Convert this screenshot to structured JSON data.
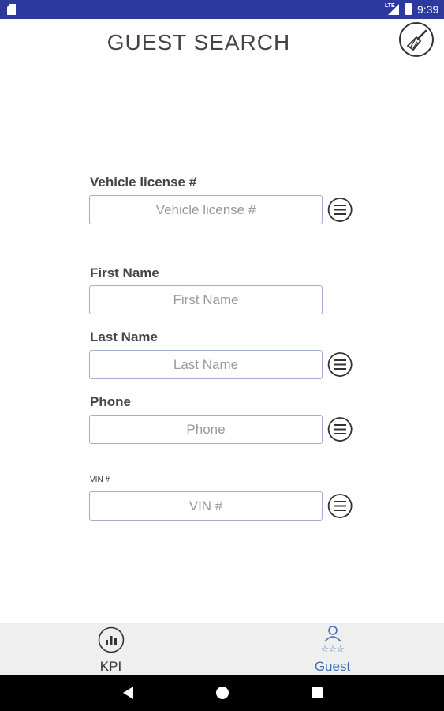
{
  "status_bar": {
    "time": "9:39",
    "network": "LTE"
  },
  "header": {
    "title": "GUEST SEARCH",
    "clear_icon": "broom-icon"
  },
  "form": {
    "vehicle_license": {
      "label": "Vehicle license #",
      "placeholder": "Vehicle license #",
      "value": ""
    },
    "first_name": {
      "label": "First Name",
      "placeholder": "First Name",
      "value": ""
    },
    "last_name": {
      "label": "Last Name",
      "placeholder": "Last Name",
      "value": ""
    },
    "phone": {
      "label": "Phone",
      "placeholder": "Phone",
      "value": ""
    },
    "vin": {
      "label": "VIN #",
      "placeholder": "VIN #",
      "value": ""
    },
    "list_icon": "list-icon"
  },
  "bottom_nav": {
    "items": [
      {
        "label": "KPI",
        "icon": "bar-chart-icon",
        "active": false
      },
      {
        "label": "Guest",
        "icon": "guest-rating-icon",
        "active": true
      }
    ],
    "active_color": "#3d6fb5"
  },
  "colors": {
    "status_bar": "#2b3a9c",
    "field_border": "#9fb0d0"
  }
}
